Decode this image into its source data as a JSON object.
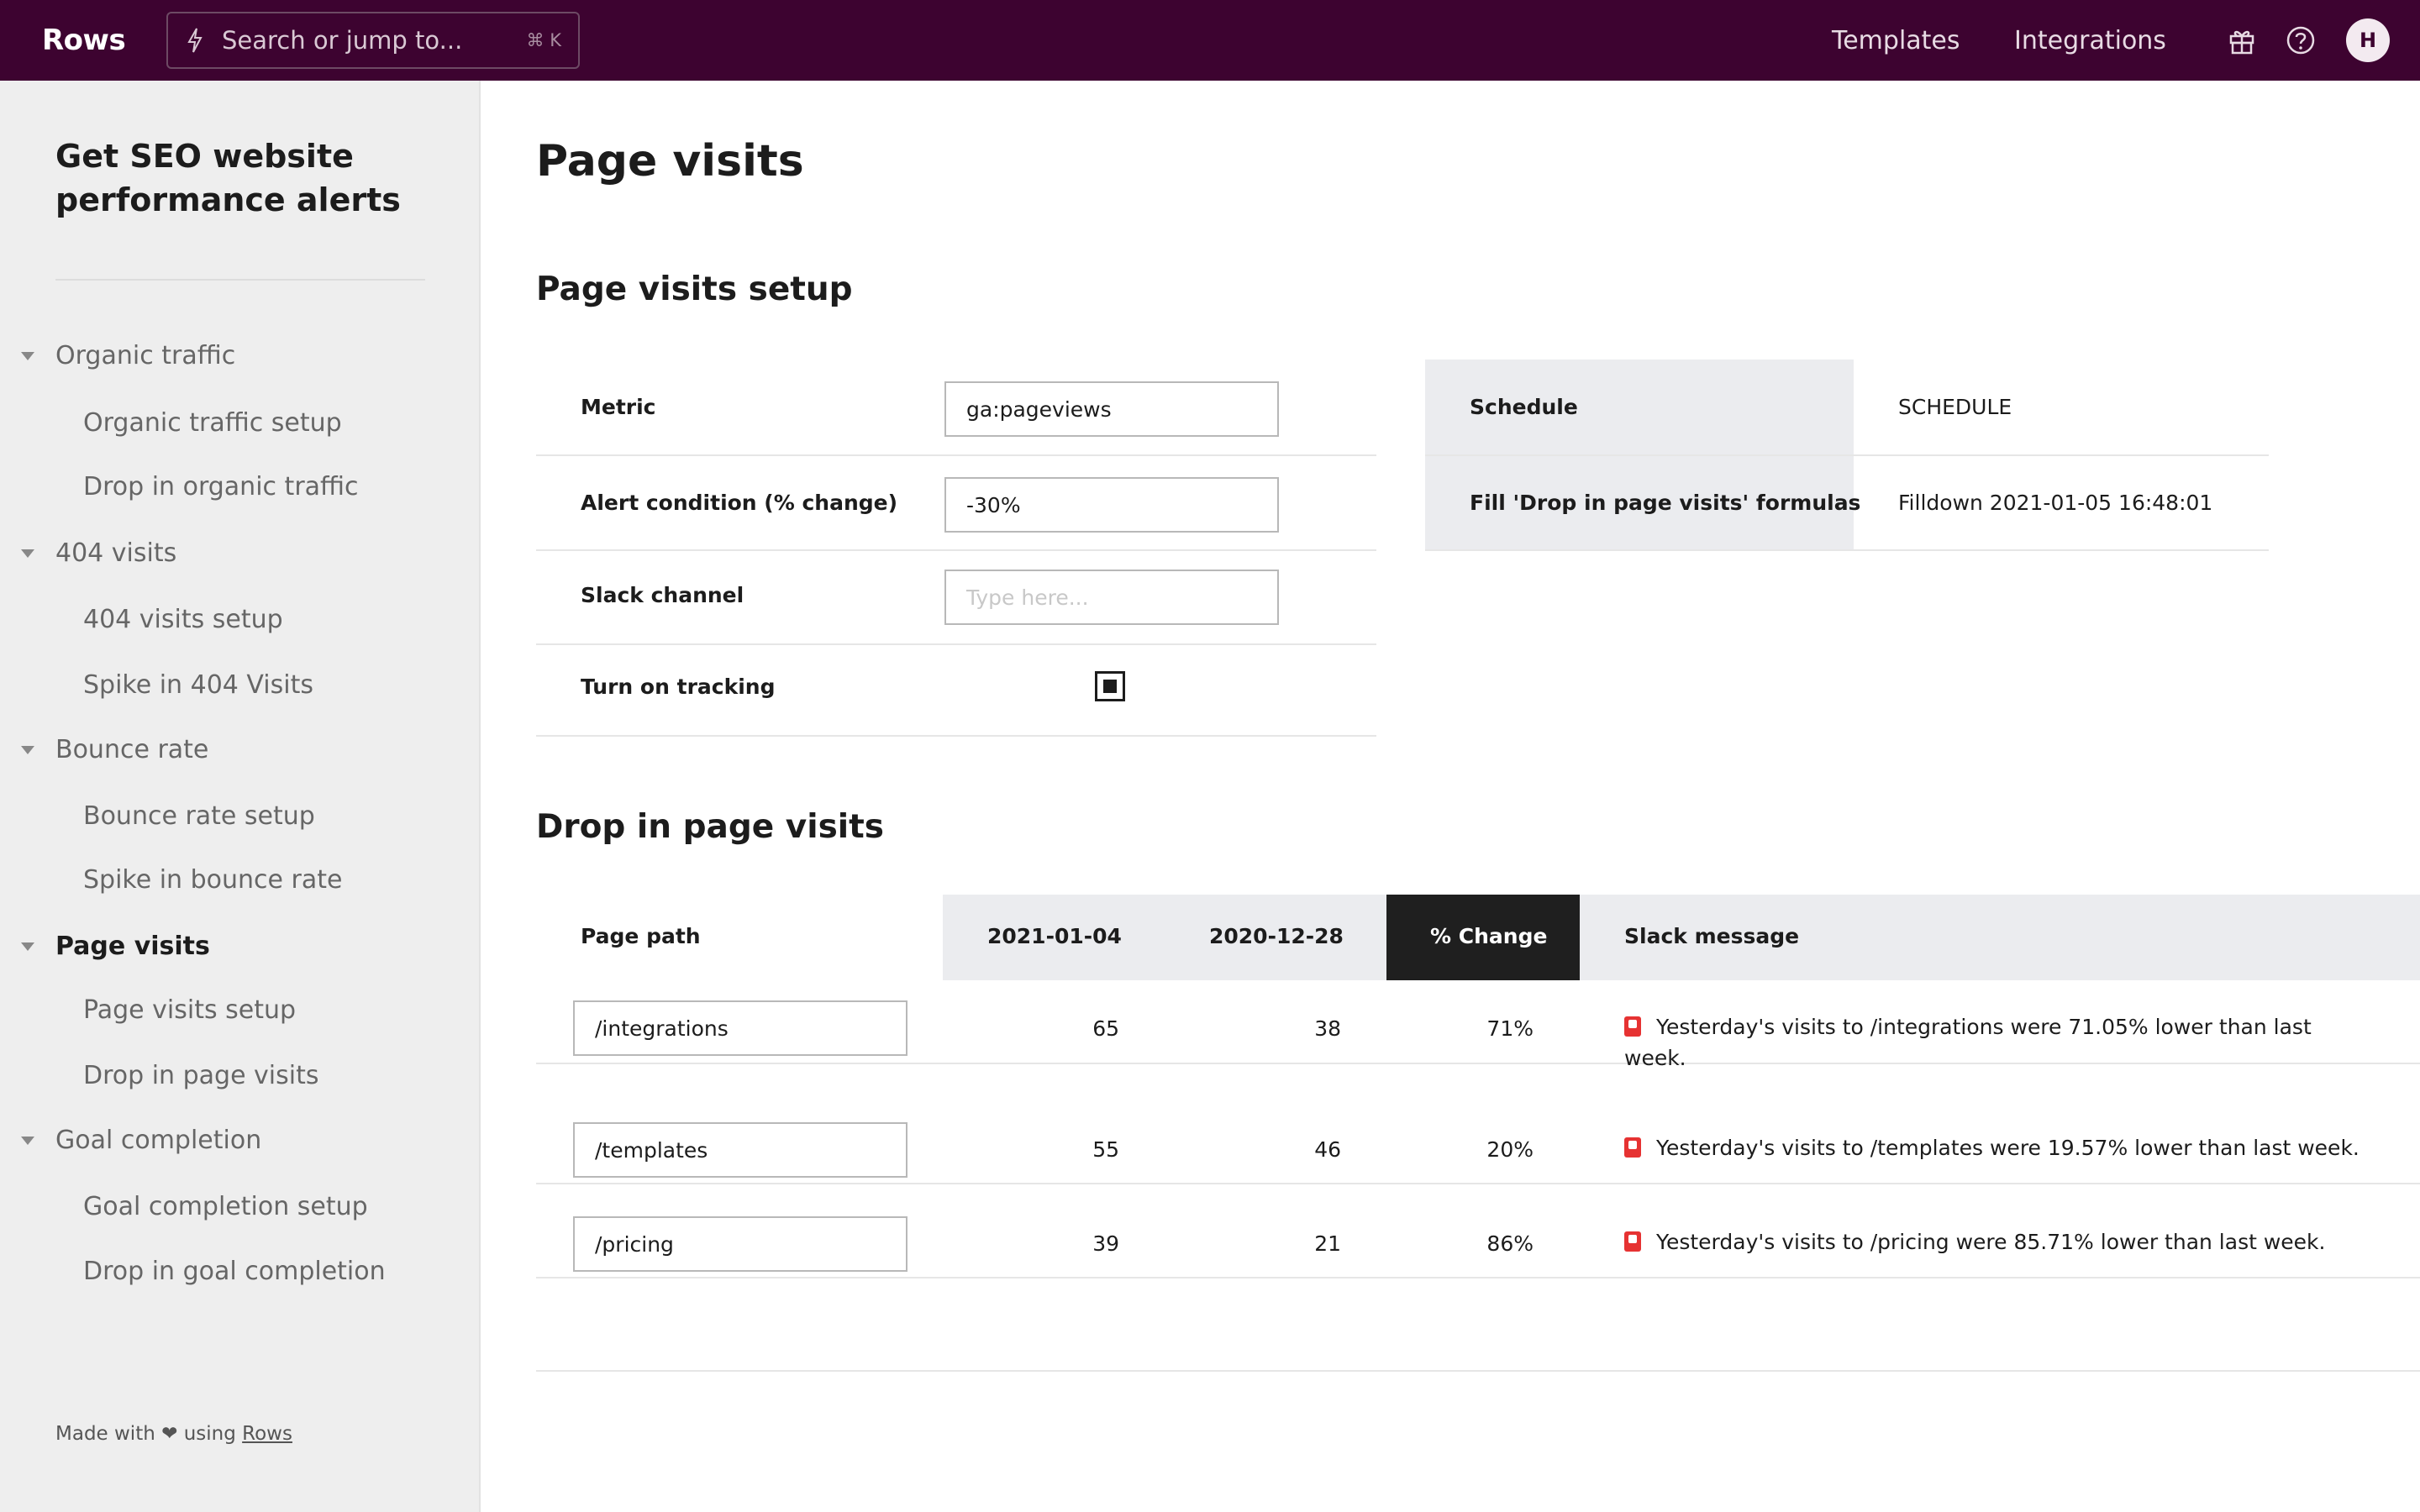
{
  "topbar": {
    "logo": "Rows",
    "search_placeholder": "Search or jump to...",
    "search_shortcut": "⌘ K",
    "nav": [
      "Templates",
      "Integrations"
    ],
    "avatar_initial": "H",
    "background": "#3d0330"
  },
  "sidebar": {
    "title": "Get SEO website performance alerts",
    "sections": [
      {
        "label": "Organic traffic",
        "items": [
          "Organic traffic setup",
          "Drop in organic traffic"
        ]
      },
      {
        "label": "404 visits",
        "items": [
          "404 visits setup",
          "Spike in 404 Visits"
        ]
      },
      {
        "label": "Bounce rate",
        "items": [
          "Bounce rate setup",
          "Spike in bounce rate"
        ]
      },
      {
        "label": "Page visits",
        "items": [
          "Page visits setup",
          "Drop in page visits"
        ]
      },
      {
        "label": "Goal completion",
        "items": [
          "Goal completion setup",
          "Drop in goal completion"
        ]
      }
    ],
    "active_section": "Page visits",
    "footer_prefix": "Made with ❤ using",
    "footer_link": "Rows"
  },
  "main": {
    "title": "Page visits",
    "setup": {
      "heading": "Page visits setup",
      "metric_label": "Metric",
      "metric_value": "ga:pageviews",
      "alert_label": "Alert condition (% change)",
      "alert_value": "-30%",
      "slack_label": "Slack channel",
      "slack_placeholder": "Type here...",
      "tracking_label": "Turn on tracking",
      "tracking_checked": true,
      "schedule_label": "Schedule",
      "schedule_value": "SCHEDULE",
      "fill_label": "Fill 'Drop in page visits' formulas",
      "fill_value": "Filldown 2021-01-05 16:48:01"
    },
    "drop": {
      "heading": "Drop in page visits",
      "columns": [
        "Page path",
        "2021-01-04",
        "2020-12-28",
        "% Change",
        "Slack message"
      ],
      "rows": [
        {
          "path": "/integrations",
          "current": "65",
          "previous": "38",
          "change": "71%",
          "message": "Yesterday's visits to /integrations were 71.05% lower than last week."
        },
        {
          "path": "/templates",
          "current": "55",
          "previous": "46",
          "change": "20%",
          "message": "Yesterday's visits to /templates were 19.57% lower than last week."
        },
        {
          "path": "/pricing",
          "current": "39",
          "previous": "21",
          "change": "86%",
          "message": "Yesterday's visits to /pricing were 85.71% lower than last week."
        }
      ]
    }
  }
}
